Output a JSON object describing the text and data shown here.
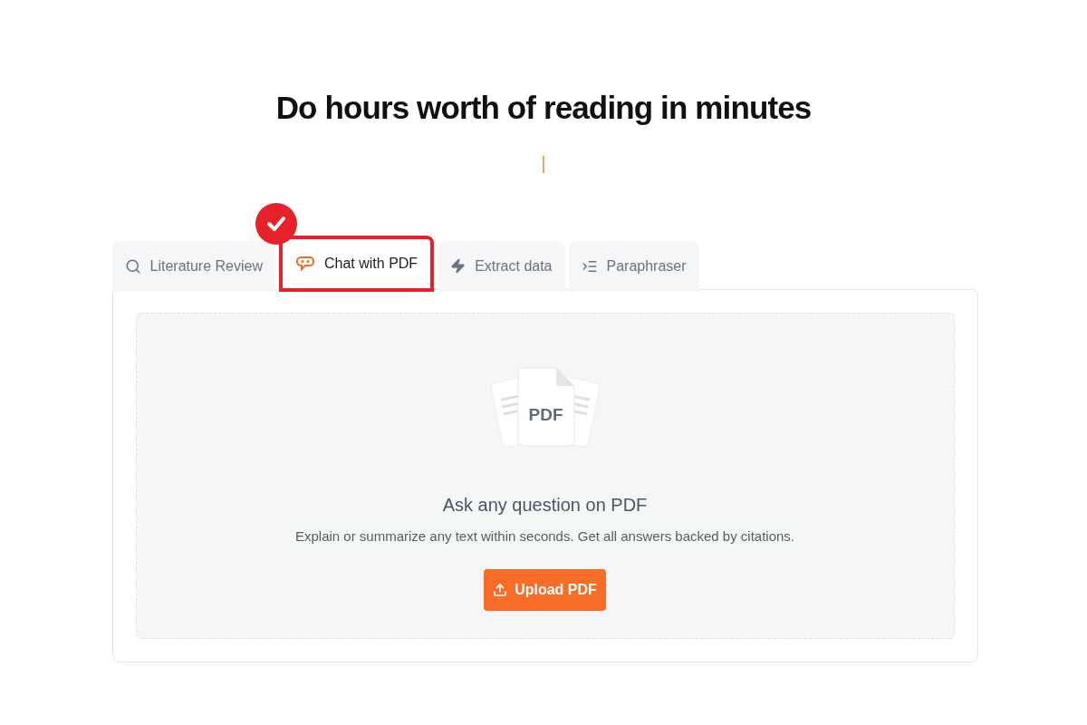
{
  "heading": "Do hours worth of reading in minutes",
  "tabs": [
    {
      "label": "Literature Review",
      "selected": false,
      "highlighted": false
    },
    {
      "label": "Chat with PDF",
      "selected": true,
      "highlighted": true
    },
    {
      "label": "Extract data",
      "selected": false,
      "highlighted": false
    },
    {
      "label": "Paraphraser",
      "selected": false,
      "highlighted": false
    }
  ],
  "upload": {
    "illustration_label": "PDF",
    "title": "Ask any question on PDF",
    "description": "Explain or summarize any text within seconds. Get all answers backed by citations.",
    "button": "Upload PDF"
  }
}
